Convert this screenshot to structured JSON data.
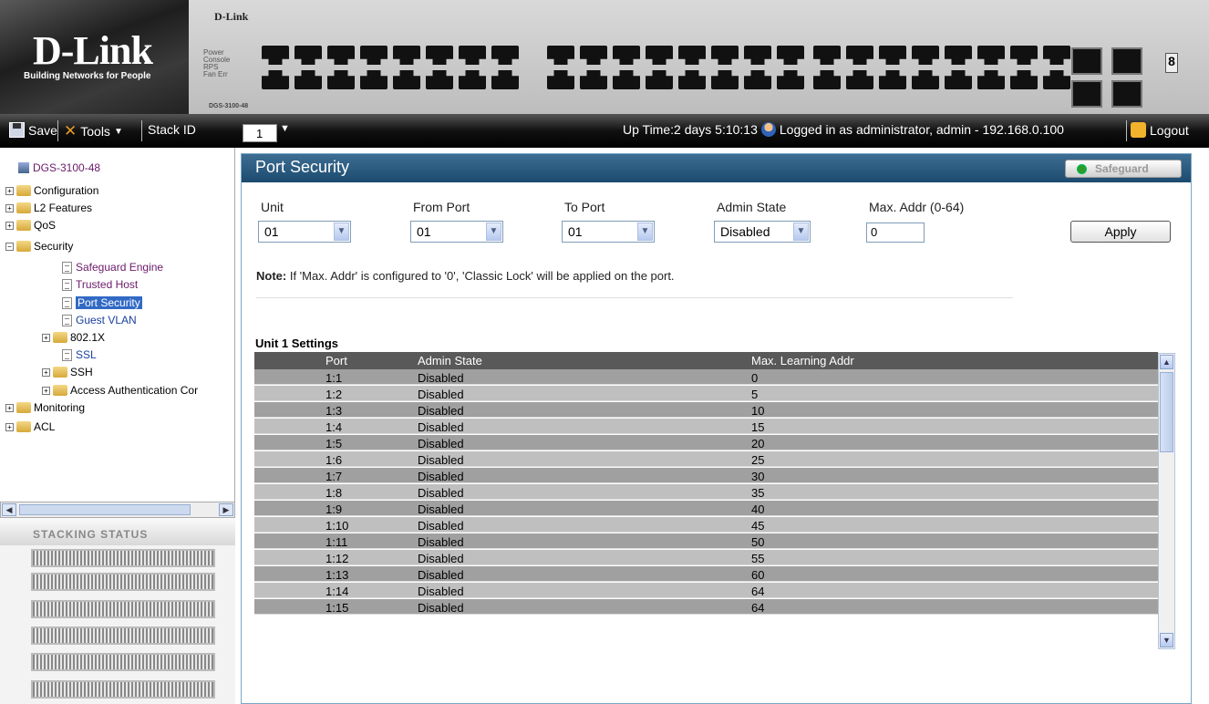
{
  "header": {
    "brand": "D-Link",
    "tagline": "Building Networks for People",
    "device_brand": "D-Link",
    "model": "DGS-3100-48",
    "leds": [
      "Power",
      "Console",
      "RPS",
      "Fan Err"
    ]
  },
  "toolbar": {
    "save_label": "Save",
    "tools_label": "Tools",
    "stack_id_label": "Stack ID",
    "stack_id_value": "1",
    "uptime": "Up Time:2 days 5:10:13",
    "login_info": "Logged in as administrator, admin - 192.168.0.100",
    "logout_label": "Logout"
  },
  "tree": {
    "root": "DGS-3100-48",
    "items": [
      {
        "label": "Configuration"
      },
      {
        "label": "L2 Features"
      },
      {
        "label": "QoS"
      },
      {
        "label": "Security"
      },
      {
        "label": "Safeguard Engine"
      },
      {
        "label": "Trusted Host"
      },
      {
        "label": "Port Security"
      },
      {
        "label": "Guest VLAN"
      },
      {
        "label": "802.1X"
      },
      {
        "label": "SSL"
      },
      {
        "label": "SSH"
      },
      {
        "label": "Access Authentication Cor"
      },
      {
        "label": "Monitoring"
      },
      {
        "label": "ACL"
      }
    ]
  },
  "stacking": {
    "title": "Stacking Status"
  },
  "main": {
    "title": "Port Security",
    "safeguard_label": "Safeguard",
    "form": {
      "unit_label": "Unit",
      "unit_value": "01",
      "from_port_label": "From Port",
      "from_port_value": "01",
      "to_port_label": "To Port",
      "to_port_value": "01",
      "admin_state_label": "Admin State",
      "admin_state_value": "Disabled",
      "max_addr_label": "Max. Addr (0-64)",
      "max_addr_value": "0",
      "apply_label": "Apply"
    },
    "note_prefix": "Note:",
    "note_text": " If 'Max. Addr' is configured to '0', 'Classic Lock' will be applied on the port.",
    "table": {
      "title": "Unit 1 Settings",
      "columns": [
        "Port",
        "Admin State",
        "Max. Learning Addr"
      ],
      "rows": [
        [
          "1:1",
          "Disabled",
          "0"
        ],
        [
          "1:2",
          "Disabled",
          "5"
        ],
        [
          "1:3",
          "Disabled",
          "10"
        ],
        [
          "1:4",
          "Disabled",
          "15"
        ],
        [
          "1:5",
          "Disabled",
          "20"
        ],
        [
          "1:6",
          "Disabled",
          "25"
        ],
        [
          "1:7",
          "Disabled",
          "30"
        ],
        [
          "1:8",
          "Disabled",
          "35"
        ],
        [
          "1:9",
          "Disabled",
          "40"
        ],
        [
          "1:10",
          "Disabled",
          "45"
        ],
        [
          "1:11",
          "Disabled",
          "50"
        ],
        [
          "1:12",
          "Disabled",
          "55"
        ],
        [
          "1:13",
          "Disabled",
          "60"
        ],
        [
          "1:14",
          "Disabled",
          "64"
        ],
        [
          "1:15",
          "Disabled",
          "64"
        ]
      ]
    }
  }
}
